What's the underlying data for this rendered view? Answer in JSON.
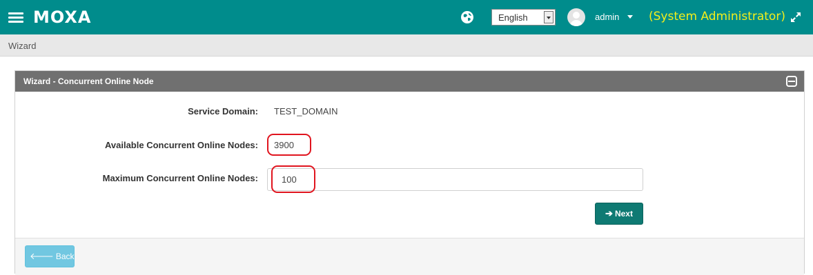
{
  "header": {
    "logo_text": "MOXA",
    "language": {
      "selected": "English"
    },
    "user": {
      "name": "admin",
      "role": "(System Administrator)"
    },
    "icons": [
      "menu-icon",
      "globe-icon",
      "user-avatar-icon",
      "caret-down-icon",
      "fullscreen-icon"
    ],
    "colors": {
      "bar": "#008c8c",
      "role_text": "#f3ef1b"
    }
  },
  "breadcrumb": {
    "current": "Wizard"
  },
  "panel": {
    "title": "Wizard - Concurrent Online Node",
    "fields": {
      "service_domain": {
        "label": "Service Domain:",
        "value": "TEST_DOMAIN"
      },
      "available_nodes": {
        "label": "Available Concurrent Online Nodes:",
        "value": "3900"
      },
      "max_nodes": {
        "label": "Maximum Concurrent Online Nodes:",
        "value": "100"
      }
    },
    "buttons": {
      "next": "Next",
      "back": "Back"
    }
  }
}
